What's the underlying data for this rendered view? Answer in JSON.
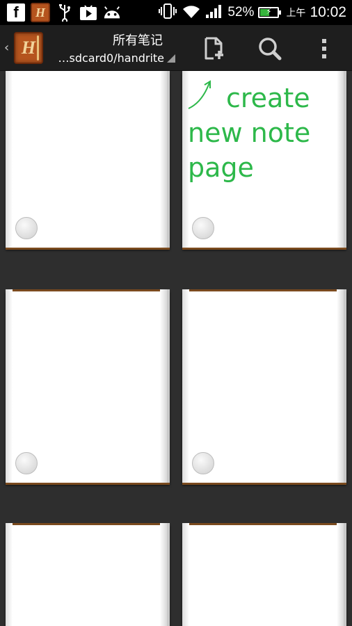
{
  "status_bar": {
    "icons": [
      "facebook-icon",
      "handrite-app-icon",
      "usb-icon",
      "play-store-icon",
      "android-icon",
      "vibrate-icon",
      "wifi-icon",
      "signal-icon",
      "battery-charging-icon"
    ],
    "fb_letter": "f",
    "battery_percent": "52%",
    "battery_level": 0.52,
    "period": "上午",
    "time": "10:02"
  },
  "action_bar": {
    "title": "所有笔记",
    "path": "…sdcard0/handrite",
    "logo_letter": "H",
    "actions": [
      "new-note-icon",
      "search-icon",
      "overflow-menu-icon"
    ]
  },
  "hint": {
    "line1": "create",
    "line2": "new note",
    "line3": "page",
    "color": "#2db84a"
  },
  "colors": {
    "background": "#2e2e2e",
    "action_bar": "#1e1e1e",
    "logo": "#b5541e"
  }
}
